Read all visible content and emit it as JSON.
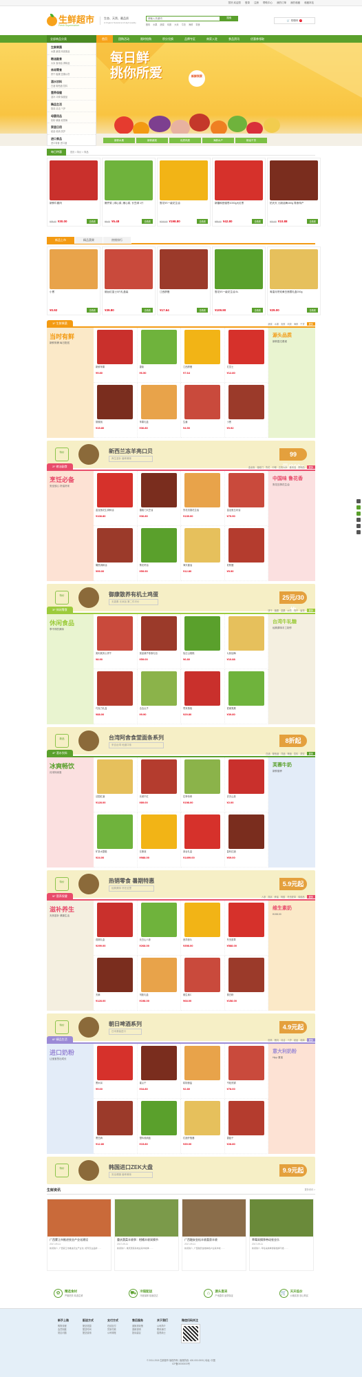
{
  "topbar": {
    "links": [
      "您好,欢迎您",
      "登录",
      "注册",
      "帮助中心",
      "我的订单",
      "我的收藏",
      "收藏本站"
    ]
  },
  "header": {
    "logo_cn": "生鲜超市",
    "logo_en": "Fresh Supermarket",
    "slogan_1": "生态、天然、最品质",
    "slogan_2": "A Organic Natural and High Quality",
    "search_placeholder": "请输入关键词",
    "search_button": "搜索",
    "hot_words": [
      "猪肉",
      "水果",
      "蔬菜",
      "鸡蛋",
      "大米",
      "牛奶",
      "海鲜",
      "零食"
    ],
    "cart_label": "购物车",
    "cart_count": "0"
  },
  "nav": {
    "category_label": "全部商品分类",
    "items": [
      "首页",
      "团购活动",
      "限时抢购",
      "积分兑换",
      "品牌专区",
      "商家入驻",
      "食品资讯",
      "优惠券领取"
    ]
  },
  "sidecats": [
    {
      "title": "生鲜果蔬",
      "sub": "水果 蔬菜 肉禽蛋品"
    },
    {
      "title": "粮油副食",
      "sub": "大米 食用油 调味品"
    },
    {
      "title": "休闲零食",
      "sub": "饼干 糖果 坚果炒货"
    },
    {
      "title": "酒水饮料",
      "sub": "白酒 葡萄酒 饮料"
    },
    {
      "title": "营养保健",
      "sub": "滋补 冲调 保健品"
    },
    {
      "title": "精品生活",
      "sub": "厨具 清洁 个护"
    },
    {
      "title": "母婴用品",
      "sub": "奶粉 辅食 纸尿裤"
    },
    {
      "title": "家居日用",
      "sub": "纸品 收纳 洗护"
    },
    {
      "title": "进口食品",
      "sub": "进口零食 进口酒"
    }
  ],
  "banner": {
    "line1": "每日鲜",
    "line2": "挑你所爱",
    "tag": "新鲜到家",
    "thumbs": [
      "新鲜水果",
      "新鲜蔬菜",
      "优质肉类",
      "海鲜水产",
      "粮油干货"
    ]
  },
  "daily": {
    "tab": "每日特惠",
    "breadcrumb": "首页 > 特价 > 商品",
    "products": [
      {
        "name": "新鲜牛腿肉",
        "old": "¥38.00",
        "price": "¥30.00",
        "btn": "去看看"
      },
      {
        "name": "嫩芹菜 | 绿心菜, 嫩心菜, 长豆绿 1斤",
        "old": "¥6.00",
        "price": "¥5.48",
        "btn": "去看看"
      },
      {
        "name": "鲁花5S一级花生油",
        "old": "¥218.00",
        "price": "¥198.80",
        "btn": "去看看"
      },
      {
        "name": "新疆和田骏枣1000g大红枣",
        "old": "¥59.00",
        "price": "¥42.80",
        "btn": "去看看"
      },
      {
        "name": "拍天天 九制话梅160g 零食特产",
        "old": "¥15.00",
        "price": "¥10.88",
        "btn": "去看看"
      }
    ]
  },
  "tabs2": {
    "tabs": [
      "新品上市",
      "精品蔬果",
      "热销排行"
    ],
    "products": [
      {
        "name": "小葱",
        "price": "¥0.92",
        "btn": "去看看"
      },
      {
        "name": "烟台红富士5斤礼盒装",
        "price": "¥39.80",
        "btn": "去看看"
      },
      {
        "name": "江西脐橙",
        "price": "¥17.64",
        "btn": "去看看"
      },
      {
        "name": "鲁花5S一级花生油 5L",
        "price": "¥109.90",
        "btn": "去看看"
      },
      {
        "name": "粤皇月饼双黄白莲蓉礼盒200g",
        "price": "¥29.00",
        "btn": "去看看"
      }
    ]
  },
  "floors": [
    {
      "label": "1F 生鲜果蔬",
      "color": "#f39a12",
      "links": [
        "蔬菜",
        "水果",
        "禽蛋",
        "肉类",
        "海鲜",
        "干货"
      ],
      "more": "更多",
      "left_h": "当时有鲜",
      "left_s": "新鲜采摘 每日配送",
      "right_h": "源头品质",
      "right_s": "新鲜直达餐桌",
      "items": [
        {
          "n": "新鲜苹果",
          "p": "¥9.80"
        },
        {
          "n": "香梨",
          "p": "¥6.50"
        },
        {
          "n": "江西脐橙",
          "p": "¥7.64"
        },
        {
          "n": "红富士",
          "p": "¥12.80"
        },
        {
          "n": "猕猴桃",
          "p": "¥15.80"
        },
        {
          "n": "苹果礼盒",
          "p": "¥36.80"
        },
        {
          "n": "生姜",
          "p": "¥4.50"
        },
        {
          "n": "小葱",
          "p": "¥0.92"
        }
      ],
      "ad": {
        "badge": "特价",
        "big": "新西兰冻羊亮口贝",
        "sub": "养生滋补 营养美味",
        "price": "99元/900g"
      }
    },
    {
      "label": "2F 粮油副食",
      "color": "#e84b6a",
      "links": [
        "金龙鱼",
        "福临门",
        "鲁花",
        "中粮",
        "五常大米",
        "食用油",
        "调味品"
      ],
      "more": "更多",
      "left_h": "烹饪必备",
      "left_s": "安全放心 好油好米",
      "right_h": "中国味 鲁花香",
      "right_s": "鲁花压榨花生油",
      "items": [
        {
          "n": "金龙鱼花生调和油",
          "p": "¥108.80"
        },
        {
          "n": "福临门大豆油",
          "p": "¥36.80"
        },
        {
          "n": "鲁花浓香花生油",
          "p": "¥139.00"
        },
        {
          "n": "金龙鱼玉米油",
          "p": "¥79.90"
        },
        {
          "n": "橄榄调和油",
          "p": "¥99.00"
        },
        {
          "n": "葵花籽油",
          "p": "¥59.90"
        },
        {
          "n": "海天酱油",
          "p": "¥12.80"
        },
        {
          "n": "老陈醋",
          "p": "¥9.90"
        }
      ],
      "ad": {
        "badge": "特价",
        "big": "御康散养有机土鸡蛋",
        "sub": "无激素 无添加 第二件半价",
        "price": "25元/30枚"
      }
    },
    {
      "label": "3F 休闲零食",
      "color": "#9ccb3b",
      "links": [
        "饼干",
        "糖果",
        "坚果",
        "炒货",
        "肉干",
        "蜜饯"
      ],
      "more": "更多",
      "left_h": "休闲食品",
      "left_s": "享不停的美味",
      "right_h": "台湾牛轧糖",
      "right_s": "经典原味手工制作",
      "items": [
        {
          "n": "奥利奥夹心饼干",
          "p": "¥8.90"
        },
        {
          "n": "良品铺子零食礼包",
          "p": "¥59.00"
        },
        {
          "n": "怡达山楂糕",
          "p": "¥6.80"
        },
        {
          "n": "九制话梅",
          "p": "¥10.88"
        },
        {
          "n": "巧克力礼盒",
          "p": "¥88.00"
        },
        {
          "n": "洽洽瓜子",
          "p": "¥9.90"
        },
        {
          "n": "枣夹核桃",
          "p": "¥29.80"
        },
        {
          "n": "夏威夷果",
          "p": "¥39.80"
        }
      ],
      "ad": {
        "badge": "新品",
        "big": "台湾阿舍食堂面条系列",
        "sub": "来自台湾 地道口味",
        "price": "8折起"
      }
    },
    {
      "label": "4F 酒水饮料",
      "color": "#5aa02c",
      "links": [
        "白酒",
        "葡萄酒",
        "洋酒",
        "啤酒",
        "饮料",
        "茶饮"
      ],
      "more": "更多",
      "left_h": "冰爽畅饮",
      "left_s": "月末特卖惠",
      "right_h": "芙蓉牛奶",
      "right_s": "新鲜营养",
      "items": [
        {
          "n": "法国红酒",
          "p": "¥128.00"
        },
        {
          "n": "长城干红",
          "p": "¥89.00"
        },
        {
          "n": "拉菲传奇",
          "p": "¥198.00"
        },
        {
          "n": "农夫山泉",
          "p": "¥2.00"
        },
        {
          "n": "矿泉水整箱",
          "p": "¥24.00"
        },
        {
          "n": "五粮液",
          "p": "¥988.00"
        },
        {
          "n": "茅台礼盒",
          "p": "¥1499.00"
        },
        {
          "n": "智利红酒",
          "p": "¥69.00"
        }
      ],
      "ad": {
        "badge": "特价",
        "big": "热销零食 暑期特惠",
        "sub": "经典美味 尽在这里",
        "price": "5.9元起"
      }
    },
    {
      "label": "5F 营养保健",
      "color": "#e84b6a",
      "links": [
        "人参",
        "燕窝",
        "蜂蜜",
        "阿胶",
        "冬虫夏草",
        "保健品"
      ],
      "more": "更多",
      "left_h": "滋补养生",
      "left_s": "天然滋补 健康生活",
      "right_h": "维生素奶",
      "right_s": "¥198.00",
      "items": [
        {
          "n": "燕窝礼盒",
          "p": "¥299.00"
        },
        {
          "n": "长白山人参",
          "p": "¥268.00"
        },
        {
          "n": "西洋参片",
          "p": "¥398.00"
        },
        {
          "n": "冬虫夏草",
          "p": "¥588.00"
        },
        {
          "n": "天麻",
          "p": "¥128.00"
        },
        {
          "n": "阿胶礼盒",
          "p": "¥198.00"
        },
        {
          "n": "维生素C",
          "p": "¥68.00"
        },
        {
          "n": "蛋白粉",
          "p": "¥158.00"
        }
      ],
      "ad": {
        "badge": "特价",
        "big": "朝日啤酒系列",
        "sub": "日本原装进口",
        "price": "4.9元起"
      }
    },
    {
      "label": "6F 精品生活",
      "color": "#9b8ad6",
      "links": [
        "厨具",
        "餐具",
        "清洁",
        "个护",
        "纸品",
        "收纳"
      ],
      "more": "更多",
      "left_h": "进口奶粉",
      "left_s": "让宝宝茁壮成长",
      "right_h": "意大利奶粉",
      "right_s": "Hipp 喜宝",
      "items": [
        {
          "n": "黑木耳",
          "p": "¥9.60"
        },
        {
          "n": "蜜瓜干",
          "p": "¥34.80"
        },
        {
          "n": "精制食盐",
          "p": "¥2.80"
        },
        {
          "n": "不粘煎锅",
          "p": "¥78.00"
        },
        {
          "n": "黑芝麻",
          "p": "¥12.80"
        },
        {
          "n": "塑料收纳篮",
          "p": "¥15.80"
        },
        {
          "n": "红酒开瓶器",
          "p": "¥39.00"
        },
        {
          "n": "香菇干",
          "p": "¥28.80"
        }
      ],
      "ad": {
        "badge": "特价",
        "big": "韩国进口ZEK大盘",
        "sub": "安全健康 营养美味",
        "price": "9.9元起"
      }
    }
  ],
  "news": {
    "title": "生鲜资讯",
    "more": "更多资讯 >",
    "items": [
      {
        "t": "广西蒙江市推进农业产业化建设",
        "d": "2017-09-11",
        "x": "新闻简介, 广西蒙江市推进农业产业化, 培育农业品牌……"
      },
      {
        "t": "重庆蔬菜丰收季：柑橘丰收采摘节",
        "d": "2017-09-11",
        "x": "新闻简介, 重庆蔬菜基地迎来丰收季……"
      },
      {
        "t": "广西融安金桔丰收喜获丰收",
        "d": "2017-09-11",
        "x": "新闻简介, 广西融安金桔种植户迎来丰收……"
      },
      {
        "t": "草莓采摘季带动农业乐",
        "d": "2017-09-11",
        "x": "新闻简介, 草莓采摘季游客络绎不绝……"
      }
    ]
  },
  "service": [
    {
      "icon": "leaf-icon",
      "h": "精选食材",
      "s": "严格把关 精选生鲜"
    },
    {
      "icon": "truck-icon",
      "h": "冷链配送",
      "s": "冷链保鲜 极速送达"
    },
    {
      "icon": "home-icon",
      "h": "源头直采",
      "s": "产地直供 品质保证"
    },
    {
      "icon": "cart-icon",
      "h": "天天低价",
      "s": "价格实惠 放心购买"
    }
  ],
  "footer": {
    "cols": [
      {
        "h": "新手上路",
        "items": [
          "购物流程",
          "会员制度",
          "常见问题"
        ]
      },
      {
        "h": "配送方式",
        "items": [
          "配送范围",
          "配送时间",
          "配送费用"
        ]
      },
      {
        "h": "支付方式",
        "items": [
          "在线支付",
          "货到付款",
          "公司转账"
        ]
      },
      {
        "h": "售后服务",
        "items": [
          "退换货政策",
          "退款说明",
          "投诉建议"
        ]
      },
      {
        "h": "关于我们",
        "items": [
          "公司简介",
          "联系我们",
          "招贤纳士"
        ]
      },
      {
        "h": "微信扫码关注",
        "items": []
      }
    ],
    "copyright": "© 2011-2018 生鲜超市 版权所有 | 客服热线: 400-000-0000 | 地址: 中国",
    "icp": "ICP备00000000号"
  }
}
